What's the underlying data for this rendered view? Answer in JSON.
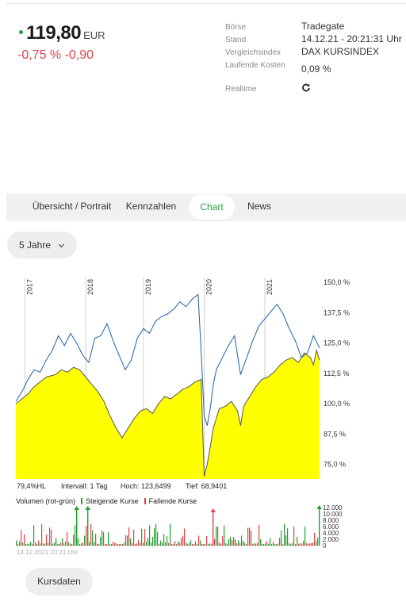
{
  "quote": {
    "price": "119,80",
    "currency": "EUR",
    "change": "-0,75 % -0,90"
  },
  "info": [
    {
      "label": "Börse",
      "value": "Tradegate"
    },
    {
      "label": "Stand",
      "value": "14.12.21 - 20:21:31 Uhr"
    },
    {
      "label": "Vergleichsindex",
      "value": "DAX KURSINDEX"
    },
    {
      "label": "Laufende Kosten",
      "value": "0,09 %"
    },
    {
      "label": "Realtime",
      "value": "",
      "icon": "refresh-icon"
    }
  ],
  "tabs": [
    {
      "label": "Übersicht / Portrait",
      "active": false
    },
    {
      "label": "Kennzahlen",
      "active": false
    },
    {
      "label": "Chart",
      "active": true
    },
    {
      "label": "News",
      "active": false
    }
  ],
  "period": {
    "label": "5 Jahre"
  },
  "chart_data": [
    {
      "type": "area",
      "x_labels": [
        "2017",
        "2018",
        "2019",
        "2020",
        "2021"
      ],
      "y_ticks": [
        "150,0 %",
        "137,5 %",
        "125,0 %",
        "112,5 %",
        "100,0 %",
        "87,5 %",
        "75,0 %"
      ],
      "ylim": [
        69,
        152
      ],
      "series": [
        {
          "name": "",
          "kind": "area",
          "color": "#ffff00",
          "line_color": "#555555",
          "x": [
            0.0,
            0.02,
            0.04,
            0.06,
            0.08,
            0.1,
            0.13,
            0.15,
            0.17,
            0.19,
            0.21,
            0.23,
            0.25,
            0.27,
            0.29,
            0.31,
            0.33,
            0.35,
            0.37,
            0.39,
            0.41,
            0.43,
            0.45,
            0.47,
            0.49,
            0.51,
            0.53,
            0.55,
            0.57,
            0.59,
            0.61,
            0.62,
            0.63,
            0.64,
            0.65,
            0.66,
            0.67,
            0.69,
            0.71,
            0.73,
            0.74,
            0.75,
            0.77,
            0.79,
            0.81,
            0.83,
            0.85,
            0.87,
            0.89,
            0.91,
            0.93,
            0.95,
            0.97,
            0.98,
            0.99,
            1.0
          ],
          "y": [
            100,
            102,
            104,
            107,
            109,
            111,
            112,
            114,
            113,
            115,
            114,
            111,
            108,
            105,
            101,
            95,
            90,
            86,
            90,
            94,
            97,
            98,
            96,
            100,
            103,
            102,
            104,
            106,
            107,
            109,
            110,
            70,
            75,
            82,
            90,
            94,
            98,
            99,
            101,
            97,
            91,
            99,
            103,
            107,
            110,
            111,
            113,
            116,
            118,
            119,
            117,
            121,
            119,
            116,
            122,
            118
          ]
        },
        {
          "name": "",
          "kind": "line",
          "color": "#1f5fa8",
          "x": [
            0.0,
            0.02,
            0.04,
            0.06,
            0.08,
            0.1,
            0.12,
            0.14,
            0.16,
            0.18,
            0.2,
            0.22,
            0.24,
            0.26,
            0.28,
            0.3,
            0.32,
            0.34,
            0.36,
            0.38,
            0.4,
            0.42,
            0.44,
            0.46,
            0.48,
            0.5,
            0.52,
            0.54,
            0.56,
            0.58,
            0.6,
            0.61,
            0.62,
            0.63,
            0.64,
            0.65,
            0.66,
            0.68,
            0.7,
            0.72,
            0.73,
            0.74,
            0.76,
            0.78,
            0.8,
            0.82,
            0.84,
            0.86,
            0.88,
            0.9,
            0.92,
            0.94,
            0.96,
            0.98,
            1.0
          ],
          "y": [
            101,
            105,
            110,
            114,
            113,
            118,
            122,
            128,
            124,
            129,
            125,
            120,
            117,
            127,
            128,
            133,
            126,
            120,
            114,
            118,
            127,
            131,
            129,
            134,
            136,
            137,
            139,
            142,
            140,
            143,
            145,
            122,
            95,
            91,
            98,
            108,
            114,
            119,
            124,
            128,
            120,
            112,
            119,
            126,
            132,
            135,
            138,
            141,
            137,
            131,
            126,
            119,
            121,
            128,
            123
          ]
        }
      ],
      "legend": {
        "label": "79,4%HL",
        "interval": "Intervall: 1 Tag",
        "high": "Hoch: 123,6499",
        "low": "Tief: 68,9401"
      }
    },
    {
      "type": "bar",
      "title": "Volumen (rot-grün)",
      "y_ticks": [
        "12.000",
        "10.000",
        "8.000",
        "6.000",
        "4.000",
        "2.000",
        "0"
      ],
      "ylim": [
        0,
        12000
      ],
      "series_names": [
        "Steigende Kurse",
        "Fallende Kurse"
      ],
      "colors": {
        "up": "#1fa02c",
        "down": "#e2434a"
      },
      "timestamp": "14.12.2021 20:21 Uhr"
    }
  ],
  "kursdaten": {
    "label": "Kursdaten"
  }
}
